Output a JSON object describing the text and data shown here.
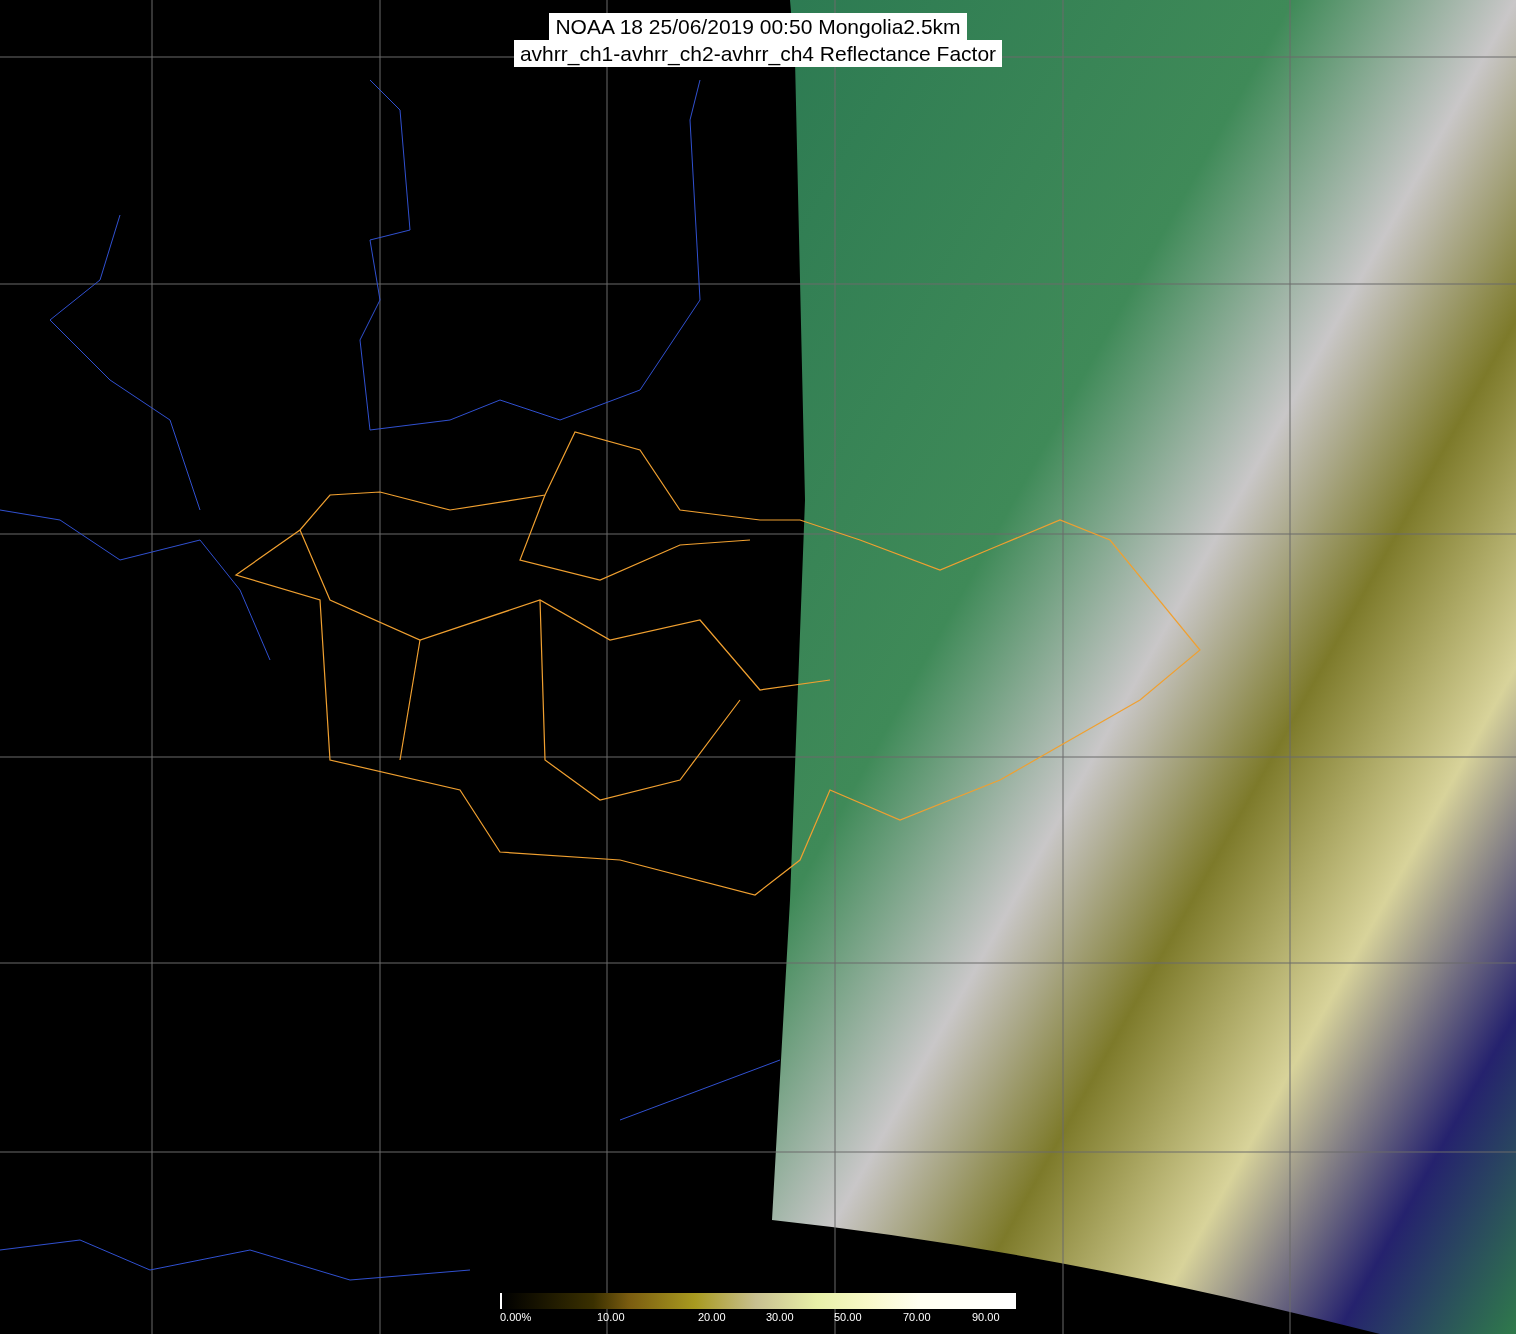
{
  "title_lines": [
    "NOAA 18 25/06/2019 00:50 Mongolia2.5km",
    "avhrr_ch1-avhrr_ch2-avhrr_ch4 Reflectance Factor"
  ],
  "colorbar": {
    "labels": [
      "0.00%",
      "10.00",
      "20.00",
      "30.00",
      "50.00",
      "70.00",
      "90.00"
    ]
  }
}
